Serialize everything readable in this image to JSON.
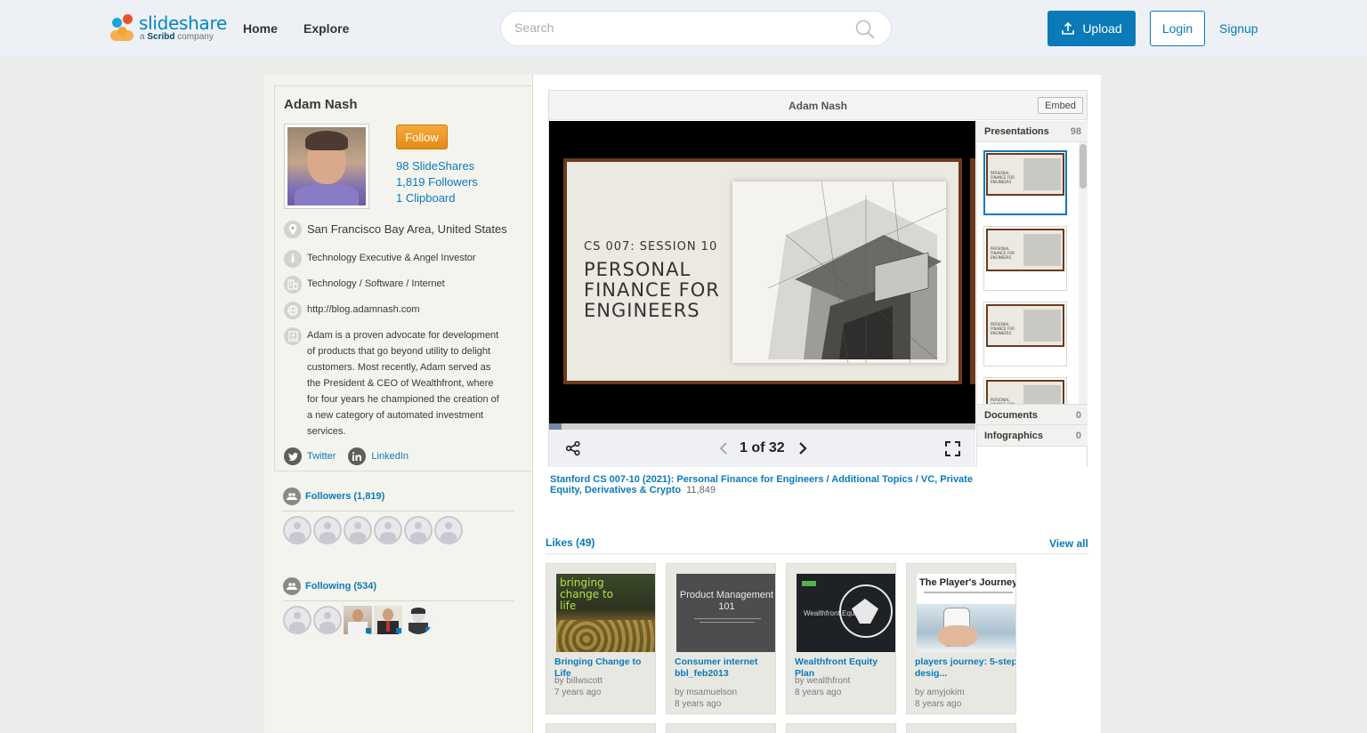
{
  "header": {
    "logo_text": "slideshare",
    "logo_sub_prefix": "a",
    "logo_sub_brand": "Scribd",
    "logo_sub_suffix": "company",
    "nav": [
      "Home",
      "Explore"
    ],
    "search_placeholder": "Search",
    "upload_label": "Upload",
    "login_label": "Login",
    "signup_label": "Signup"
  },
  "profile": {
    "name": "Adam Nash",
    "follow_label": "Follow",
    "stats": [
      "98 SlideShares",
      "1,819 Followers",
      "1 Clipboard"
    ],
    "location": "San Francisco Bay Area, United States",
    "occupation": "Technology Executive & Angel Investor",
    "industry": "Technology / Software / Internet",
    "website": "http://blog.adamnash.com",
    "about": "Adam is a proven advocate for development of products that go beyond utility to delight customers. Most recently, Adam served as the President & CEO of Wealthfront, where for four years he championed the creation of a new category of automated investment services.",
    "twitter_label": "Twitter",
    "linkedin_label": "LinkedIn",
    "followers_title": "Followers (1,819)",
    "following_title": "Following (534)"
  },
  "player": {
    "title": "Adam Nash",
    "embed_label": "Embed",
    "slide_kicker": "CS 007: SESSION 10",
    "slide_title": "PERSONAL FINANCE FOR ENGINEERS",
    "page_count": "1 of 32",
    "progress": 0.03,
    "tabs": [
      {
        "label": "Presentations",
        "count": "98"
      },
      {
        "label": "Documents",
        "count": "0"
      },
      {
        "label": "Infographics",
        "count": "0"
      }
    ],
    "doc_title": "Stanford CS 007-10 (2021): Personal Finance for Engineers / Additional Topics / VC, Private Equity, Derivatives & Crypto",
    "doc_views": "11,849"
  },
  "likes": {
    "title": "Likes (49)",
    "view_all": "View all",
    "items": [
      {
        "title": "Bringing Change to Life",
        "by": "by billwscott",
        "ago": "7 years ago",
        "thumb_text": "bringing change to life"
      },
      {
        "title": "Consumer internet bbl_feb2013",
        "by": "by msamuelson",
        "ago": "8 years ago",
        "thumb_text": "Product Management 101"
      },
      {
        "title": "Wealthfront Equity Plan",
        "by": "by wealthfront",
        "ago": "8 years ago",
        "thumb_text": "Wealthfront Equity"
      },
      {
        "title": "players journey: 5-step desig...",
        "by": "by amyjokim",
        "ago": "8 years ago",
        "thumb_text": "The Player's Journey"
      }
    ]
  },
  "colors": {
    "accent": "#0a7ab9",
    "follow": "#e58b12",
    "slide_border": "#6b3a1c"
  }
}
